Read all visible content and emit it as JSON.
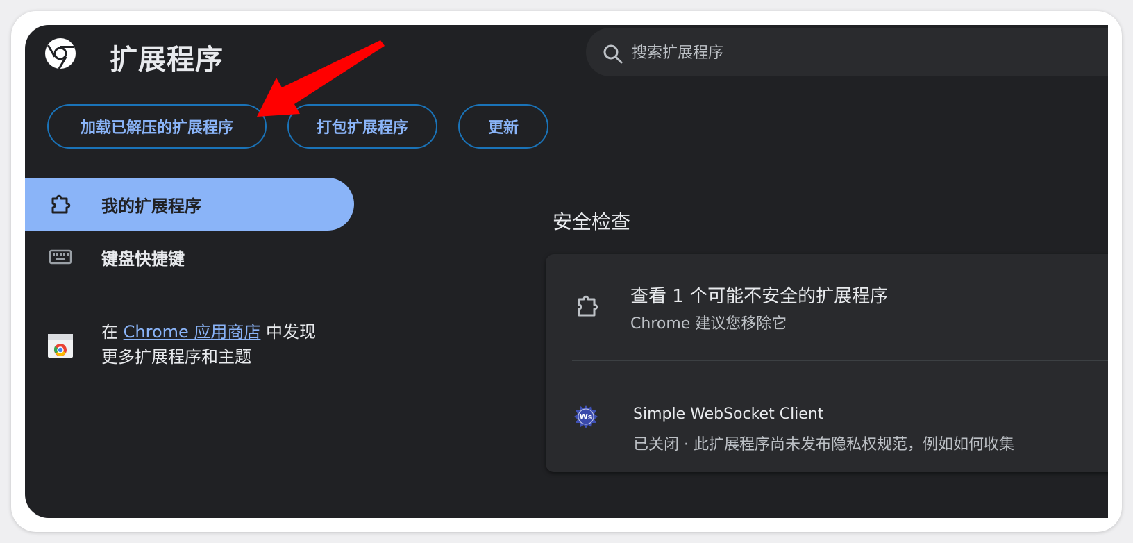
{
  "header": {
    "title": "扩展程序",
    "logo_icon": "chrome-logo-icon",
    "search": {
      "placeholder": "搜索扩展程序",
      "icon": "search-icon"
    }
  },
  "toolbar": {
    "load_unpacked": "加载已解压的扩展程序",
    "pack": "打包扩展程序",
    "update": "更新"
  },
  "sidebar": {
    "items": [
      {
        "label": "我的扩展程序",
        "icon": "puzzle-icon",
        "active": true
      },
      {
        "label": "键盘快捷键",
        "icon": "keyboard-icon",
        "active": false
      }
    ],
    "store": {
      "prefix": "在 ",
      "link": "Chrome 应用商店",
      "suffix": " 中发现",
      "line2": "更多扩展程序和主题",
      "icon": "chrome-web-store-icon"
    }
  },
  "main": {
    "section_title": "安全检查",
    "card": {
      "title": "查看 1 个可能不安全的扩展程序",
      "subtitle": "Chrome 建议您移除它",
      "extension": {
        "name": "Simple WebSocket Client",
        "description": "已关闭 · 此扩展程序尚未发布隐私权规范，例如如何收集",
        "icon": "ws-badge-icon"
      }
    }
  },
  "colors": {
    "background": "#202124",
    "accent": "#8ab4f8",
    "button_border": "#1a73b8",
    "annotation_arrow": "#ff0000"
  }
}
